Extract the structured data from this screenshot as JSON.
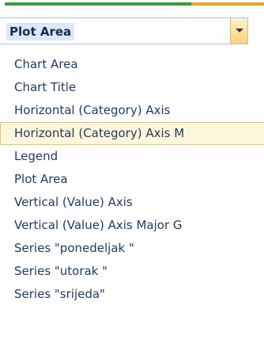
{
  "combo": {
    "selected_value": "Plot Area"
  },
  "list": {
    "items": [
      {
        "label": "Chart Area"
      },
      {
        "label": "Chart Title"
      },
      {
        "label": "Horizontal (Category) Axis"
      },
      {
        "label": "Horizontal (Category) Axis M"
      },
      {
        "label": "Legend"
      },
      {
        "label": "Plot Area"
      },
      {
        "label": "Vertical (Value) Axis"
      },
      {
        "label": "Vertical (Value) Axis Major G"
      },
      {
        "label": "Series \"ponedeljak \""
      },
      {
        "label": "Series \"utorak \""
      },
      {
        "label": "Series \"srijeda\""
      }
    ],
    "highlighted_index": 3
  },
  "colors": {
    "accent_green": "#3c9a3c",
    "accent_orange": "#e3a72f",
    "text": "#1f3a5c",
    "highlight_bg": "#fff7dc",
    "highlight_border": "#e6c466",
    "selection_bg": "#dbe8f8"
  }
}
